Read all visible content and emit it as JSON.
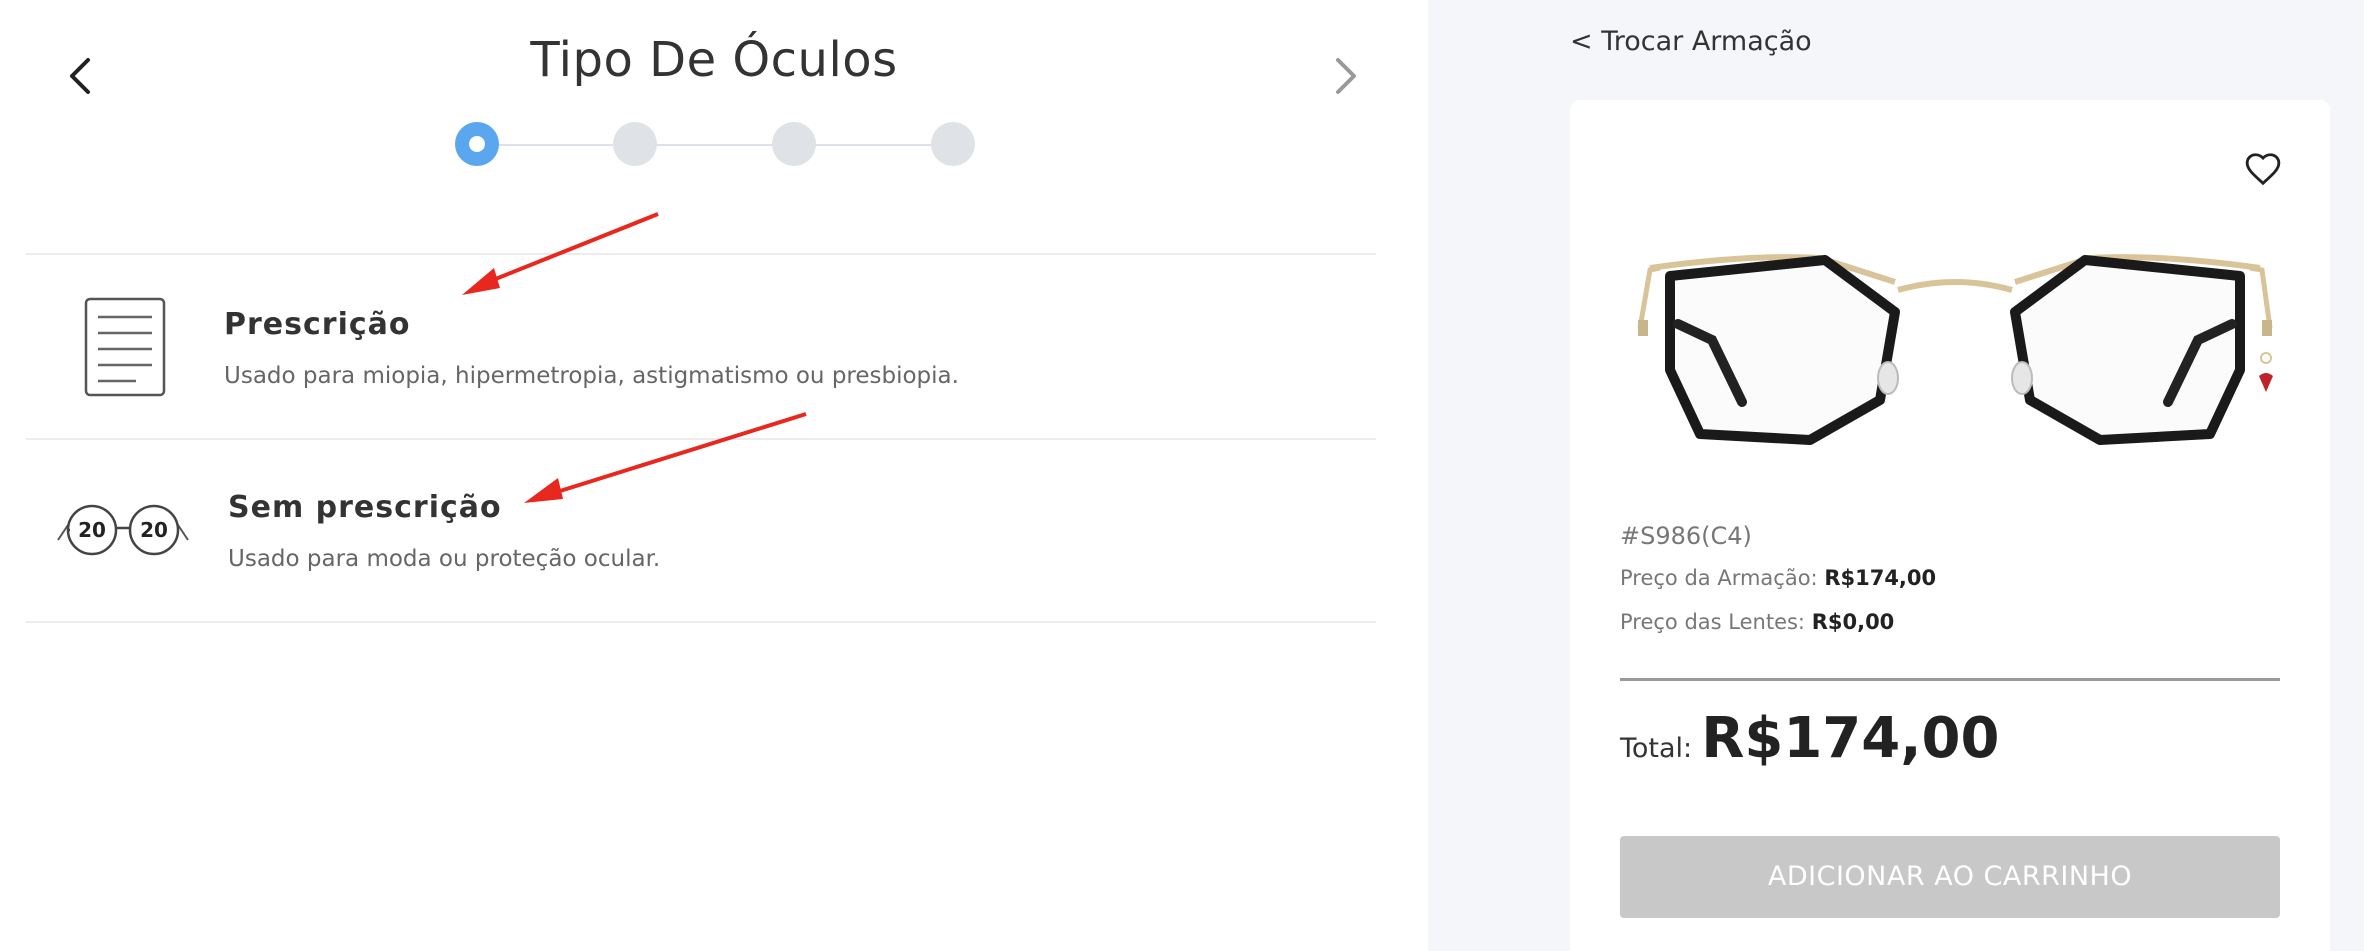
{
  "page": {
    "title": "Tipo De Óculos"
  },
  "stepper": {
    "steps": 4,
    "active_step": 1
  },
  "options": [
    {
      "title": "Prescrição",
      "description": "Usado para miopia, hipermetropia, astigmatismo ou presbiopia.",
      "icon": "document-icon"
    },
    {
      "title": "Sem prescrição",
      "description": "Usado para moda ou proteção ocular.",
      "icon": "20-20-glasses-icon",
      "icon_text": [
        "20",
        "20"
      ]
    }
  ],
  "summary": {
    "change_frame": "< Trocar Armação",
    "sku": "#S986(C4)",
    "frame_price_label": "Preço da Armação:",
    "frame_price": "R$174,00",
    "lens_price_label": "Preço das Lentes:",
    "lens_price": "R$0,00",
    "total_label": "Total:",
    "total_value": "R$174,00",
    "add_to_cart": "ADICIONAR AO CARRINHO"
  },
  "colors": {
    "accent": "#5aa7f0",
    "step_inactive": "#dfe3e8",
    "button_disabled": "#c8c8c8",
    "annotation_arrow": "#e8271e",
    "panel_bg": "#f4f6f9"
  }
}
